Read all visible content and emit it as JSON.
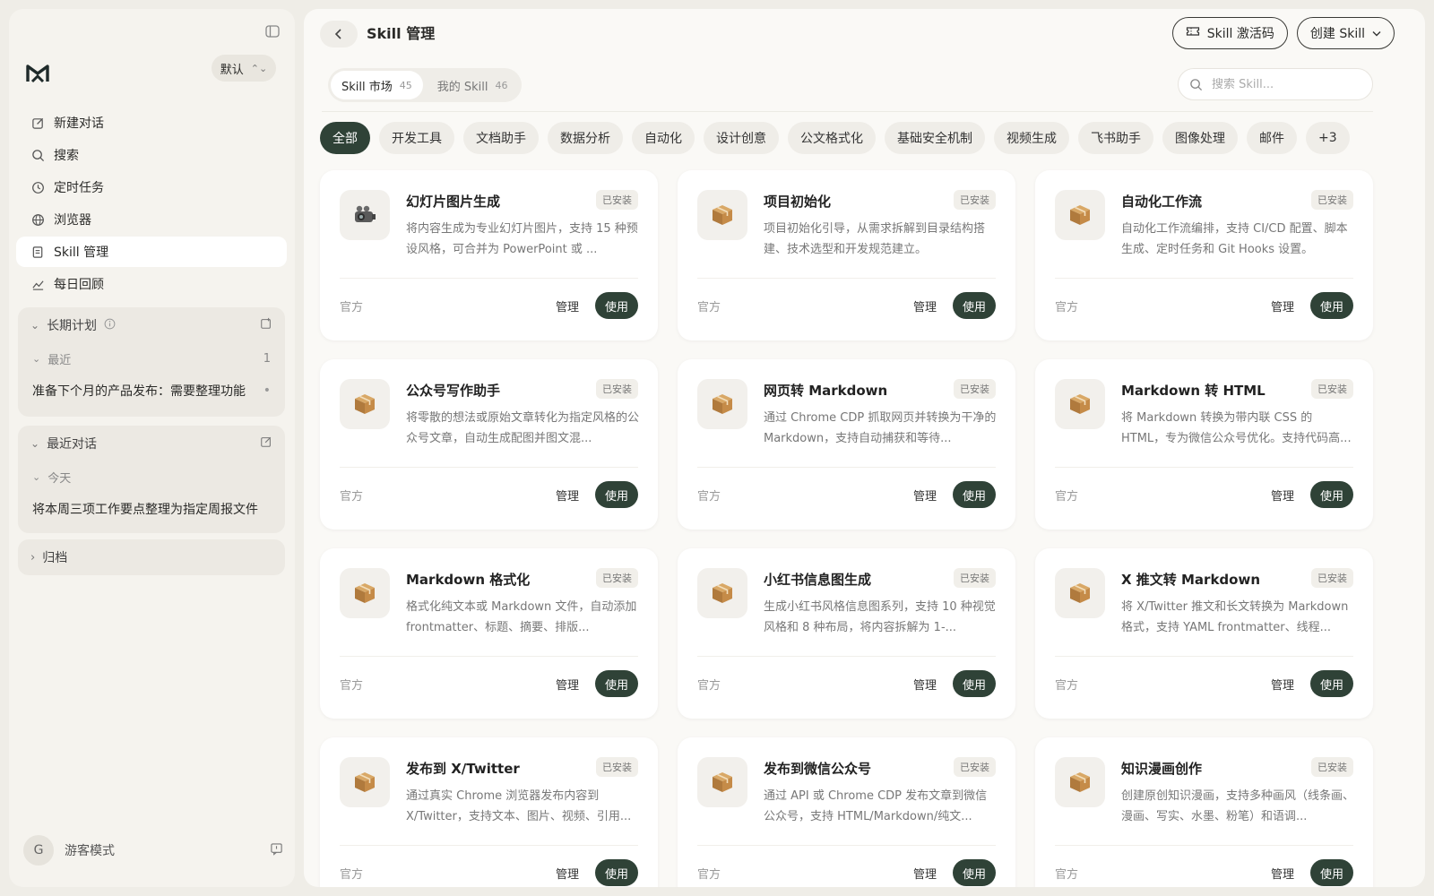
{
  "sidebar": {
    "workspace": "默认",
    "nav": [
      {
        "label": "新建对话",
        "icon": "edit-icon"
      },
      {
        "label": "搜索",
        "icon": "search-icon"
      },
      {
        "label": "定时任务",
        "icon": "clock-icon"
      },
      {
        "label": "浏览器",
        "icon": "globe-icon"
      },
      {
        "label": "Skill 管理",
        "icon": "skill-icon",
        "active": true
      },
      {
        "label": "每日回顾",
        "icon": "chart-icon"
      }
    ],
    "long_term": {
      "title": "长期计划",
      "sub": "最近",
      "sub_count": "1",
      "entry": "准备下个月的产品发布：需要整理功能"
    },
    "recent": {
      "title": "最近对话",
      "sub": "今天",
      "entry": "将本周三项工作要点整理为指定周报文件"
    },
    "archive": {
      "title": "归档"
    },
    "user": {
      "initial": "G",
      "name": "游客模式"
    }
  },
  "header": {
    "title": "Skill 管理",
    "activation_label": "Skill 激活码",
    "create_label": "创建 Skill"
  },
  "tabs": [
    {
      "label": "Skill 市场",
      "count": "45",
      "active": true
    },
    {
      "label": "我的 Skill",
      "count": "46",
      "active": false
    }
  ],
  "search": {
    "placeholder": "搜索 Skill..."
  },
  "categories": [
    "全部",
    "开发工具",
    "文档助手",
    "数据分析",
    "自动化",
    "设计创意",
    "公文格式化",
    "基础安全机制",
    "视频生成",
    "飞书助手",
    "图像处理",
    "邮件",
    "+3"
  ],
  "common": {
    "badge": "已安装",
    "source": "官方",
    "manage": "管理",
    "use": "使用"
  },
  "cards": [
    {
      "title": "幻灯片图片生成",
      "icon": "projector-icon",
      "desc": "将内容生成为专业幻灯片图片，支持 15 种预设风格，可合并为 PowerPoint 或 ..."
    },
    {
      "title": "项目初始化",
      "icon": "package-icon",
      "desc": "项目初始化引导，从需求拆解到目录结构搭建、技术选型和开发规范建立。"
    },
    {
      "title": "自动化工作流",
      "icon": "package-icon",
      "desc": "自动化工作流编排，支持 CI/CD 配置、脚本生成、定时任务和 Git Hooks 设置。"
    },
    {
      "title": "公众号写作助手",
      "icon": "package-icon",
      "desc": "将零散的想法或原始文章转化为指定风格的公众号文章，自动生成配图并图文混..."
    },
    {
      "title": "网页转 Markdown",
      "icon": "package-icon",
      "desc": "通过 Chrome CDP 抓取网页并转换为干净的 Markdown，支持自动捕获和等待..."
    },
    {
      "title": "Markdown 转 HTML",
      "icon": "package-icon",
      "desc": "将 Markdown 转换为带内联 CSS 的 HTML，专为微信公众号优化。支持代码高..."
    },
    {
      "title": "Markdown 格式化",
      "icon": "package-icon",
      "desc": "格式化纯文本或 Markdown 文件，自动添加 frontmatter、标题、摘要、排版..."
    },
    {
      "title": "小红书信息图生成",
      "icon": "package-icon",
      "desc": "生成小红书风格信息图系列，支持 10 种视觉风格和 8 种布局，将内容拆解为 1-..."
    },
    {
      "title": "X 推文转 Markdown",
      "icon": "package-icon",
      "desc": "将 X/Twitter 推文和长文转换为 Markdown 格式，支持 YAML frontmatter、线程..."
    },
    {
      "title": "发布到 X/Twitter",
      "icon": "package-icon",
      "desc": "通过真实 Chrome 浏览器发布内容到 X/Twitter，支持文本、图片、视频、引用..."
    },
    {
      "title": "发布到微信公众号",
      "icon": "package-icon",
      "desc": "通过 API 或 Chrome CDP 发布文章到微信公众号，支持 HTML/Markdown/纯文..."
    },
    {
      "title": "知识漫画创作",
      "icon": "package-icon",
      "desc": "创建原创知识漫画，支持多种画风（线条画、漫画、写实、水墨、粉笔）和语调..."
    }
  ]
}
